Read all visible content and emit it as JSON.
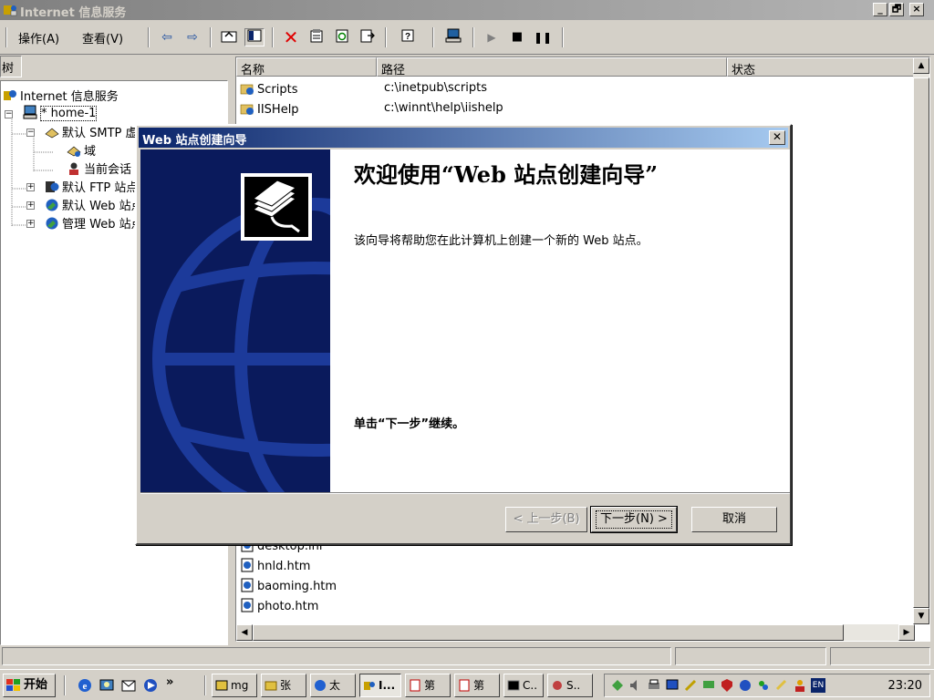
{
  "window": {
    "title": "Internet 信息服务",
    "controls": [
      "_",
      "🗗",
      "×"
    ]
  },
  "menu": {
    "action": "操作(A)",
    "view": "查看(V)"
  },
  "tree": {
    "header": "树",
    "items": [
      {
        "label": "Internet 信息服务"
      },
      {
        "label": "* home-1"
      },
      {
        "label": "默认 SMTP 虚拟服务器"
      },
      {
        "label": "域"
      },
      {
        "label": "当前会话"
      },
      {
        "label": "默认 FTP 站点"
      },
      {
        "label": "默认 Web 站点"
      },
      {
        "label": "管理 Web 站点"
      }
    ]
  },
  "list": {
    "columns": {
      "name": "名称",
      "path": "路径",
      "status": "状态"
    },
    "top_rows": [
      {
        "name": "Scripts",
        "path": "c:\\inetpub\\scripts"
      },
      {
        "name": "IISHelp",
        "path": "c:\\winnt\\help\\iishelp"
      }
    ],
    "bottom_rows": [
      {
        "name": "desktop.ini"
      },
      {
        "name": "hnld.htm"
      },
      {
        "name": "baoming.htm"
      },
      {
        "name": "photo.htm"
      }
    ]
  },
  "dialog": {
    "title": "Web 站点创建向导",
    "heading": "欢迎使用“Web 站点创建向导”",
    "description": "该向导将帮助您在此计算机上创建一个新的 Web 站点。",
    "continue_hint": "单击“下一步”继续。",
    "buttons": {
      "back": "< 上一步(B)",
      "next": "下一步(N) >",
      "cancel": "取消"
    }
  },
  "taskbar": {
    "start": "开始",
    "chevron": "»",
    "tasks": [
      "mg",
      "张",
      "太",
      "I...",
      "第",
      "第",
      "C..",
      "S.."
    ],
    "clock": "23:20",
    "lang": "EN"
  },
  "colors": {
    "title_active": "#0a246a",
    "title_inactive": "#808080",
    "face": "#d4d0c8",
    "art_bg": "#0a1a5c"
  }
}
